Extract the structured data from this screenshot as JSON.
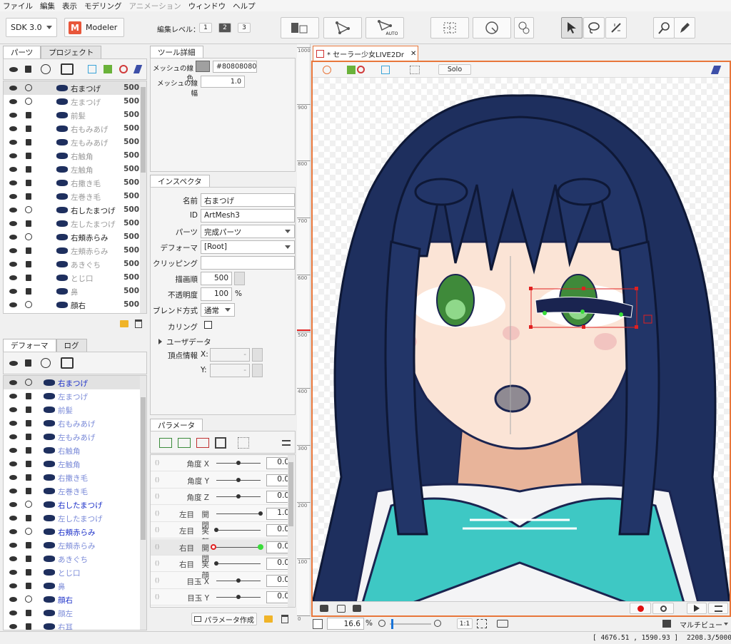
{
  "menu": [
    "ファイル",
    "編集",
    "表示",
    "モデリング",
    "アニメーション",
    "ウィンドウ",
    "ヘルプ"
  ],
  "menu_disabled": [
    4
  ],
  "toolbar": {
    "sdk": "SDK 3.0",
    "mode": "Modeler",
    "edit_level_label": "編集レベル：",
    "levels": [
      "1",
      "2",
      "3"
    ],
    "active_level": 1,
    "auto": "AUTO"
  },
  "parts_panel": {
    "tabs": [
      "パーツ",
      "プロジェクト"
    ],
    "rows": [
      {
        "name": "右まつげ",
        "value": "500",
        "style": "sel",
        "lock": "open"
      },
      {
        "name": "左まつげ",
        "value": "500",
        "style": "grey",
        "lock": "open"
      },
      {
        "name": "前髪",
        "value": "500",
        "style": "grey",
        "lock": "closed"
      },
      {
        "name": "右もみあげ",
        "value": "500",
        "style": "grey",
        "lock": "closed"
      },
      {
        "name": "左もみあげ",
        "value": "500",
        "style": "grey",
        "lock": "closed"
      },
      {
        "name": "右触角",
        "value": "500",
        "style": "grey",
        "lock": "closed"
      },
      {
        "name": "左触角",
        "value": "500",
        "style": "grey",
        "lock": "closed"
      },
      {
        "name": "右撒き毛",
        "value": "500",
        "style": "grey",
        "lock": "closed"
      },
      {
        "name": "左巻き毛",
        "value": "500",
        "style": "grey",
        "lock": "closed"
      },
      {
        "name": "右したまつげ",
        "value": "500",
        "style": "dark",
        "lock": "open"
      },
      {
        "name": "左したまつげ",
        "value": "500",
        "style": "grey",
        "lock": "closed"
      },
      {
        "name": "右頬赤らみ",
        "value": "500",
        "style": "dark",
        "lock": "open"
      },
      {
        "name": "左頬赤らみ",
        "value": "500",
        "style": "grey",
        "lock": "closed"
      },
      {
        "name": "あきぐち",
        "value": "500",
        "style": "grey",
        "lock": "closed"
      },
      {
        "name": "とじ口",
        "value": "500",
        "style": "grey",
        "lock": "closed"
      },
      {
        "name": "鼻",
        "value": "500",
        "style": "grey",
        "lock": "closed"
      },
      {
        "name": "顔右",
        "value": "500",
        "style": "dark",
        "lock": "open"
      }
    ]
  },
  "deformer_panel": {
    "tabs": [
      "デフォーマ",
      "ログ"
    ],
    "rows": [
      {
        "name": "右まつげ",
        "style": "blue-sel",
        "lock": "open"
      },
      {
        "name": "左まつげ",
        "style": "lblue",
        "lock": "closed"
      },
      {
        "name": "前髪",
        "style": "lblue",
        "lock": "closed"
      },
      {
        "name": "右もみあげ",
        "style": "lblue",
        "lock": "closed"
      },
      {
        "name": "左もみあげ",
        "style": "lblue",
        "lock": "closed"
      },
      {
        "name": "右触角",
        "style": "lblue",
        "lock": "closed"
      },
      {
        "name": "左触角",
        "style": "lblue",
        "lock": "closed"
      },
      {
        "name": "右撒き毛",
        "style": "lblue",
        "lock": "closed"
      },
      {
        "name": "左巻き毛",
        "style": "lblue",
        "lock": "closed"
      },
      {
        "name": "右したまつげ",
        "style": "blue",
        "lock": "open"
      },
      {
        "name": "左したまつげ",
        "style": "lblue",
        "lock": "closed"
      },
      {
        "name": "右頬赤らみ",
        "style": "blue",
        "lock": "open"
      },
      {
        "name": "左頬赤らみ",
        "style": "lblue",
        "lock": "closed"
      },
      {
        "name": "あきぐち",
        "style": "lblue",
        "lock": "closed"
      },
      {
        "name": "とじ口",
        "style": "lblue",
        "lock": "closed"
      },
      {
        "name": "鼻",
        "style": "lblue",
        "lock": "closed"
      },
      {
        "name": "顔右",
        "style": "blue",
        "lock": "open"
      },
      {
        "name": "顔左",
        "style": "lblue",
        "lock": "closed"
      },
      {
        "name": "右耳",
        "style": "lblue",
        "lock": "closed"
      }
    ]
  },
  "tool_detail": {
    "tab": "ツール詳細",
    "mesh_color_label": "メッシュの線色",
    "mesh_color_value": "#80808080",
    "mesh_width_label": "メッシュの線幅",
    "mesh_width_value": "1.0"
  },
  "inspector": {
    "tab": "インスペクタ",
    "name_label": "名前",
    "name_value": "右まつげ",
    "id_label": "ID",
    "id_value": "ArtMesh3",
    "part_label": "パーツ",
    "part_value": "完成パーツ",
    "deformer_label": "デフォーマ",
    "deformer_value": "[Root]",
    "clipping_label": "クリッピング",
    "clipping_value": "",
    "draw_order_label": "描画順",
    "draw_order_value": "500",
    "opacity_label": "不透明度",
    "opacity_value": "100",
    "opacity_unit": "%",
    "blend_label": "ブレンド方式",
    "blend_value": "通常",
    "culling_label": "カリング",
    "userdata_label": "ユーザデータ",
    "vertex_label": "頂点情報",
    "x_label": "X:",
    "y_label": "Y:",
    "x_value": "-",
    "y_value": "-"
  },
  "parameters": {
    "tab": "パラメータ",
    "create_button": "パラメータ作成",
    "rows": [
      {
        "name": "角度 X",
        "value": "0.0",
        "level": 0.5
      },
      {
        "name": "角度 Y",
        "value": "0.0",
        "level": 0.5
      },
      {
        "name": "角度 Z",
        "value": "0.0",
        "level": 0.5
      },
      {
        "name": "左目　開閉",
        "value": "1.0",
        "level": 1.0
      },
      {
        "name": "左目　笑顔",
        "value": "0.0",
        "level": 0.0
      },
      {
        "name": "右目　開閉",
        "value": "0.0",
        "level": 0.0,
        "active": true
      },
      {
        "name": "右目　笑顔",
        "value": "0.0",
        "level": 0.0
      },
      {
        "name": "目玉 X",
        "value": "0.0",
        "level": 0.5
      },
      {
        "name": "目玉 Y",
        "value": "0.0",
        "level": 0.5
      }
    ]
  },
  "canvas": {
    "tab_title": "* セーラー少女LIVE2Dr",
    "solo": "Solo",
    "zoom": "16.6",
    "zoom_unit": "%",
    "ratio": "1:1",
    "multiview": "マルチビュー",
    "ruler": [
      "1000",
      "900",
      "800",
      "700",
      "600",
      "500",
      "400",
      "300",
      "200",
      "100",
      "0"
    ]
  },
  "status": {
    "coords": "[ 4676.51 , 1590.93 ]",
    "size": "2208.3/5000."
  }
}
